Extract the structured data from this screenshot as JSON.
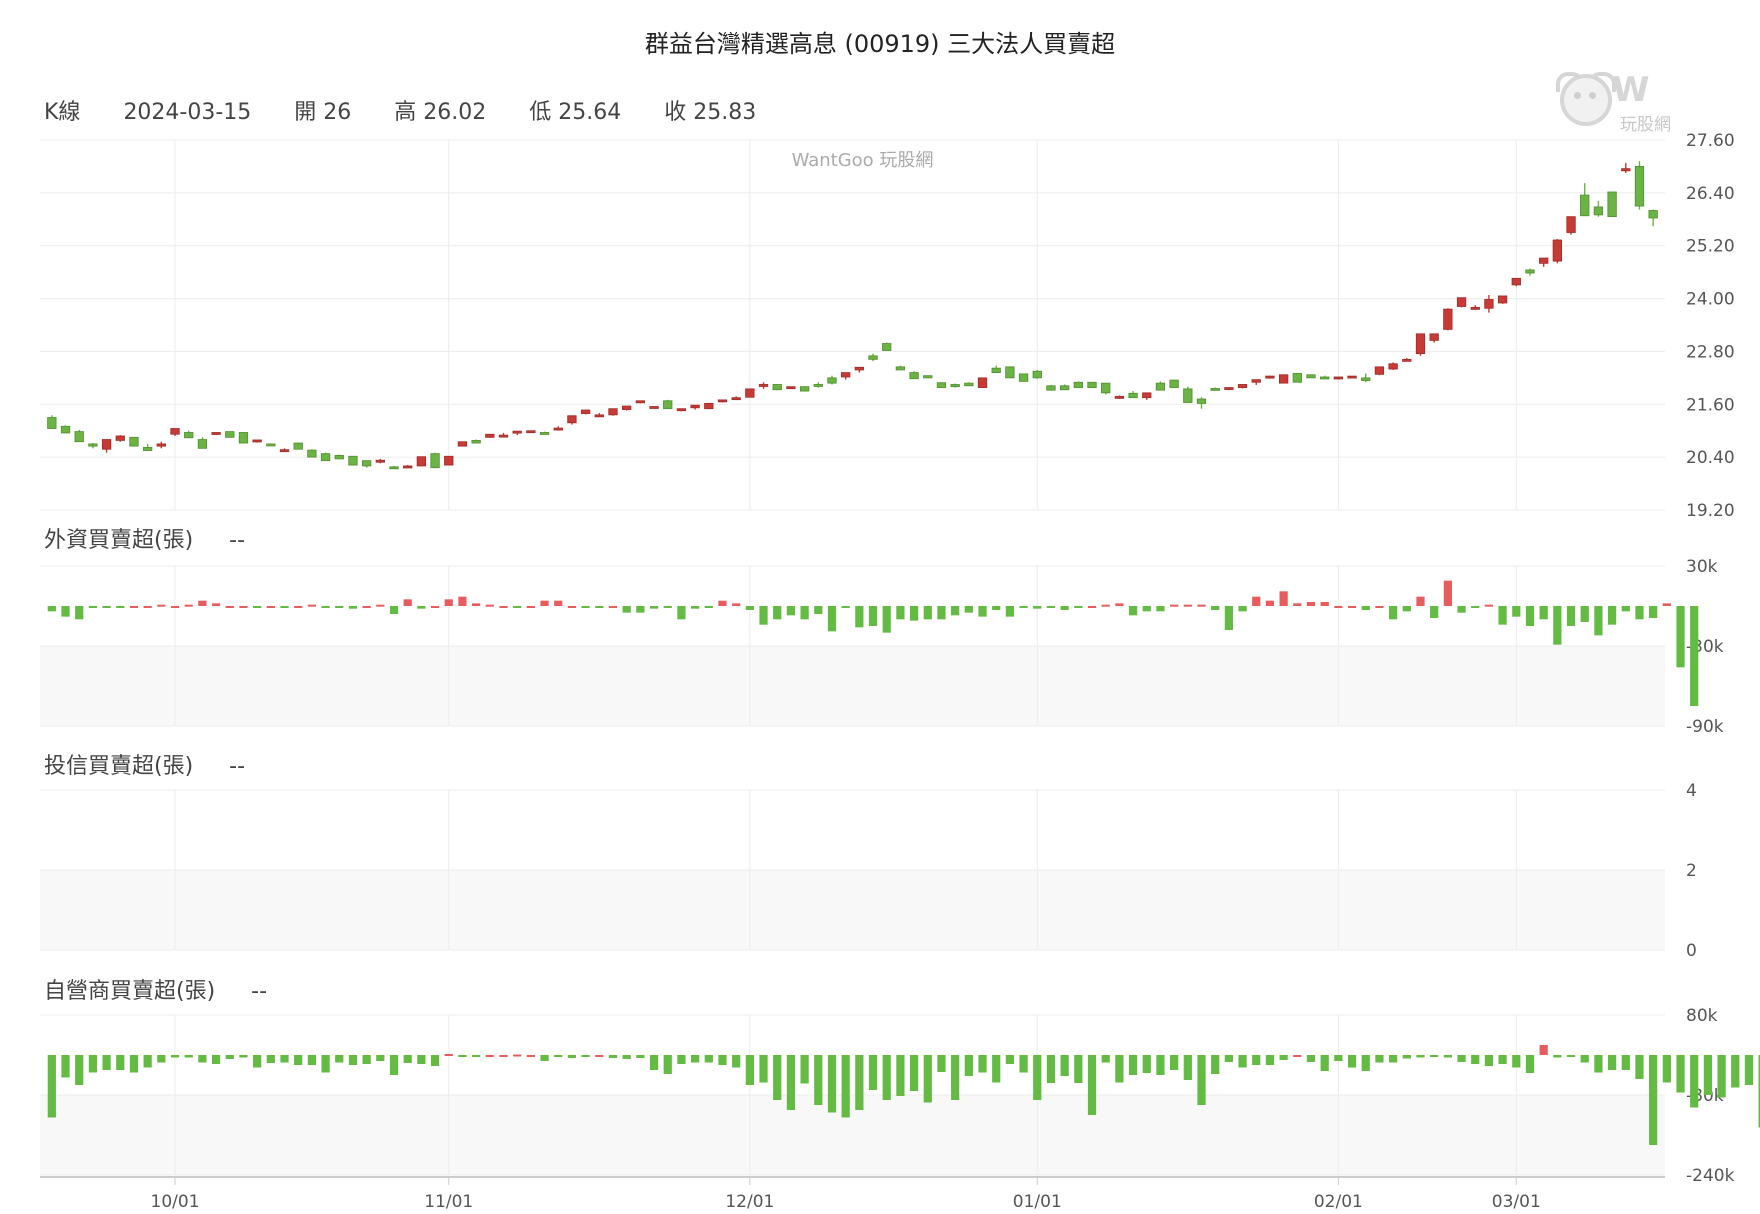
{
  "title": "群益台灣精選高息 (00919) 三大法人買賣超",
  "kline_info": {
    "label": "K線",
    "date": "2024-03-15",
    "open": "開 26",
    "high": "高 26.02",
    "low": "低 25.64",
    "close": "收 25.83"
  },
  "watermark": "WantGoo 玩股網",
  "logo_text": "玩股網",
  "panels": {
    "foreign": {
      "title": "外資買賣超(張)",
      "value": "--"
    },
    "trust": {
      "title": "投信買賣超(張)",
      "value": "--"
    },
    "dealer": {
      "title": "自營商買賣超(張)",
      "value": "--"
    }
  },
  "colors": {
    "up": "#c83a35",
    "down": "#6ab344",
    "up_bar": "#e75c5c",
    "down_bar": "#63bb43",
    "grid": "#ececec",
    "band": "#f8f8f8"
  },
  "chart_data": [
    {
      "type": "candlestick",
      "ylim": [
        19.2,
        27.6
      ],
      "y_ticks": [
        "27.60",
        "26.40",
        "25.20",
        "24.00",
        "22.80",
        "21.60",
        "20.40",
        "19.20"
      ],
      "x_ticks": [
        "10/01",
        "11/01",
        "12/01",
        "01/01",
        "02/01",
        "03/01"
      ],
      "x_tick_index": [
        9,
        29,
        51,
        72,
        94,
        107
      ],
      "ohlc": [
        [
          21.3,
          21.35,
          21.05,
          21.05
        ],
        [
          21.1,
          21.12,
          20.95,
          20.95
        ],
        [
          20.98,
          21.02,
          20.75,
          20.75
        ],
        [
          20.7,
          20.72,
          20.6,
          20.65
        ],
        [
          20.58,
          20.8,
          20.5,
          20.8
        ],
        [
          20.78,
          20.9,
          20.75,
          20.88
        ],
        [
          20.85,
          20.85,
          20.65,
          20.65
        ],
        [
          20.62,
          20.7,
          20.55,
          20.55
        ],
        [
          20.65,
          20.75,
          20.6,
          20.7
        ],
        [
          20.92,
          21.02,
          20.88,
          21.05
        ],
        [
          20.96,
          21.0,
          20.84,
          20.84
        ],
        [
          20.8,
          20.85,
          20.6,
          20.6
        ],
        [
          20.92,
          20.95,
          20.9,
          20.96
        ],
        [
          20.98,
          20.98,
          20.85,
          20.85
        ],
        [
          20.96,
          20.96,
          20.72,
          20.72
        ],
        [
          20.75,
          20.78,
          20.73,
          20.79
        ],
        [
          20.7,
          20.7,
          20.68,
          20.66
        ],
        [
          20.56,
          20.6,
          20.55,
          20.57
        ],
        [
          20.72,
          20.72,
          20.58,
          20.58
        ],
        [
          20.56,
          20.58,
          20.4,
          20.4
        ],
        [
          20.48,
          20.5,
          20.32,
          20.32
        ],
        [
          20.44,
          20.46,
          20.36,
          20.36
        ],
        [
          20.42,
          20.42,
          20.22,
          20.22
        ],
        [
          20.32,
          20.32,
          20.16,
          20.2
        ],
        [
          20.31,
          20.36,
          20.26,
          20.33
        ],
        [
          20.18,
          20.2,
          20.14,
          20.14
        ],
        [
          20.2,
          20.22,
          20.18,
          20.2
        ],
        [
          20.2,
          20.41,
          20.19,
          20.41
        ],
        [
          20.48,
          20.5,
          20.16,
          20.16
        ],
        [
          20.22,
          20.42,
          20.21,
          20.42
        ],
        [
          20.65,
          20.75,
          20.65,
          20.75
        ],
        [
          20.78,
          20.8,
          20.72,
          20.72
        ],
        [
          20.85,
          20.9,
          20.84,
          20.92
        ],
        [
          20.9,
          20.95,
          20.88,
          20.9
        ],
        [
          20.95,
          20.98,
          20.9,
          20.99
        ],
        [
          20.96,
          21.0,
          20.95,
          21.0
        ],
        [
          20.96,
          20.98,
          20.94,
          20.94
        ],
        [
          21.05,
          21.1,
          21.03,
          21.06
        ],
        [
          21.18,
          21.2,
          21.14,
          21.34
        ],
        [
          21.39,
          21.42,
          21.37,
          21.47
        ],
        [
          21.34,
          21.4,
          21.33,
          21.36
        ],
        [
          21.36,
          21.42,
          21.34,
          21.5
        ],
        [
          21.48,
          21.52,
          21.46,
          21.56
        ],
        [
          21.66,
          21.68,
          21.62,
          21.68
        ],
        [
          21.55,
          21.55,
          21.54,
          21.55
        ],
        [
          21.68,
          21.7,
          21.5,
          21.5
        ],
        [
          21.46,
          21.48,
          21.44,
          21.5
        ],
        [
          21.52,
          21.58,
          21.48,
          21.58
        ],
        [
          21.5,
          21.5,
          21.5,
          21.62
        ],
        [
          21.66,
          21.7,
          21.64,
          21.7
        ],
        [
          21.72,
          21.78,
          21.7,
          21.75
        ],
        [
          21.76,
          21.9,
          21.76,
          21.95
        ],
        [
          22.05,
          22.1,
          21.95,
          22.05
        ],
        [
          22.05,
          22.05,
          21.93,
          21.93
        ],
        [
          21.98,
          22.0,
          21.96,
          22.0
        ],
        [
          22.0,
          22.0,
          21.9,
          21.9
        ],
        [
          22.05,
          22.1,
          21.98,
          22.04
        ],
        [
          22.2,
          22.25,
          22.05,
          22.08
        ],
        [
          22.22,
          22.3,
          22.16,
          22.32
        ],
        [
          22.38,
          22.42,
          22.32,
          22.44
        ],
        [
          22.7,
          22.75,
          22.58,
          22.62
        ],
        [
          22.98,
          23.0,
          22.82,
          22.82
        ],
        [
          22.45,
          22.48,
          22.42,
          22.38
        ],
        [
          22.32,
          22.35,
          22.18,
          22.18
        ],
        [
          22.25,
          22.25,
          22.2,
          22.2
        ],
        [
          22.09,
          22.1,
          21.98,
          21.98
        ],
        [
          22.05,
          22.07,
          21.98,
          22.0
        ],
        [
          22.08,
          22.1,
          22.03,
          22.02
        ],
        [
          21.98,
          22.2,
          21.98,
          22.2
        ],
        [
          22.42,
          22.48,
          22.38,
          22.32
        ],
        [
          22.45,
          22.45,
          22.2,
          22.2
        ],
        [
          22.29,
          22.3,
          22.12,
          22.12
        ],
        [
          22.35,
          22.38,
          22.18,
          22.2
        ],
        [
          22.02,
          22.04,
          21.92,
          21.92
        ],
        [
          22.02,
          22.05,
          21.93,
          21.93
        ],
        [
          22.1,
          22.12,
          21.98,
          21.98
        ],
        [
          22.1,
          22.1,
          21.98,
          21.98
        ],
        [
          22.08,
          22.08,
          21.82,
          21.86
        ],
        [
          21.76,
          21.8,
          21.72,
          21.78
        ],
        [
          21.85,
          21.9,
          21.8,
          21.75
        ],
        [
          21.75,
          21.85,
          21.7,
          21.86
        ],
        [
          22.08,
          22.12,
          21.95,
          21.92
        ],
        [
          22.15,
          22.15,
          21.98,
          21.98
        ],
        [
          21.95,
          22.0,
          21.64,
          21.64
        ],
        [
          21.72,
          21.76,
          21.5,
          21.62
        ],
        [
          21.96,
          21.98,
          21.94,
          21.92
        ],
        [
          21.95,
          21.98,
          21.92,
          21.98
        ],
        [
          21.98,
          22.02,
          21.96,
          22.05
        ],
        [
          22.1,
          22.14,
          22.04,
          22.16
        ],
        [
          22.2,
          22.25,
          22.18,
          22.24
        ],
        [
          22.08,
          22.28,
          22.08,
          22.27
        ],
        [
          22.3,
          22.3,
          22.1,
          22.1
        ],
        [
          22.27,
          22.27,
          22.2,
          22.2
        ],
        [
          22.22,
          22.25,
          22.18,
          22.2
        ],
        [
          22.22,
          22.22,
          22.16,
          22.22
        ],
        [
          22.22,
          22.23,
          22.2,
          22.24
        ],
        [
          22.2,
          22.3,
          22.1,
          22.14
        ],
        [
          22.28,
          22.45,
          22.26,
          22.45
        ],
        [
          22.4,
          22.55,
          22.38,
          22.52
        ],
        [
          22.6,
          22.65,
          22.58,
          22.62
        ],
        [
          22.75,
          23.2,
          22.7,
          23.2
        ],
        [
          23.05,
          23.2,
          23.0,
          23.2
        ],
        [
          23.3,
          23.78,
          23.28,
          23.76
        ],
        [
          23.82,
          23.9,
          23.8,
          24.02
        ],
        [
          23.8,
          23.85,
          23.75,
          23.8
        ],
        [
          23.78,
          24.08,
          23.68,
          23.98
        ],
        [
          23.9,
          24.05,
          23.88,
          24.06
        ],
        [
          24.31,
          24.32,
          24.28,
          24.46
        ],
        [
          24.65,
          24.68,
          24.52,
          24.58
        ],
        [
          24.8,
          24.85,
          24.72,
          24.92
        ],
        [
          24.85,
          25.35,
          24.8,
          25.33
        ],
        [
          25.5,
          25.85,
          25.45,
          25.86
        ],
        [
          26.35,
          26.62,
          25.95,
          25.88
        ],
        [
          26.08,
          26.22,
          25.86,
          25.9
        ],
        [
          26.42,
          26.42,
          25.86,
          25.86
        ],
        [
          26.9,
          27.08,
          26.85,
          26.95
        ],
        [
          27.0,
          27.12,
          26.02,
          26.1
        ],
        [
          26.0,
          26.02,
          25.64,
          25.83
        ]
      ],
      "foreign_ylim": [
        -90,
        30
      ],
      "foreign_ticks": [
        "30k",
        "-30k",
        "-90k"
      ],
      "foreign": [
        -4,
        -8,
        -10,
        -1,
        -1,
        -1,
        0,
        0,
        1,
        0,
        1,
        4,
        2,
        0,
        0,
        -1,
        0,
        -1,
        0,
        1,
        -1,
        -1,
        -2,
        0,
        1,
        -6,
        5,
        -2,
        0,
        5,
        7,
        2,
        1,
        0,
        -1,
        0,
        4,
        4,
        0,
        -1,
        -1,
        0,
        -5,
        -5,
        -2,
        -1,
        -10,
        -2,
        -1,
        4,
        2,
        -3,
        -14,
        -10,
        -7,
        -10,
        -6,
        -19,
        -1,
        -16,
        -15,
        -20,
        -10,
        -11,
        -10,
        -10,
        -7,
        -5,
        -8,
        -3,
        -8,
        -1,
        -2,
        -1,
        -3,
        -1,
        0,
        1,
        2,
        -7,
        -4,
        -4,
        1,
        1,
        1,
        -3,
        -18,
        -4,
        7,
        4,
        11,
        2,
        3,
        3,
        0,
        0,
        -3,
        0,
        -10,
        -4,
        7,
        -9,
        19,
        -5,
        -1,
        1,
        -14,
        -8,
        -15,
        -10,
        -29,
        -15,
        -12,
        -22,
        -14,
        -4,
        -10,
        -9,
        2,
        -46,
        -75
      ],
      "trust_ylim": [
        0,
        4
      ],
      "trust_ticks": [
        "4",
        "2",
        "0"
      ],
      "trust": [],
      "dealer_ylim": [
        -240,
        80
      ],
      "dealer_ticks": [
        "80k",
        "-80k",
        "-240k"
      ],
      "dealer": [
        -125,
        -45,
        -60,
        -35,
        -30,
        -30,
        -35,
        -25,
        -15,
        -5,
        -5,
        -15,
        -18,
        -8,
        -5,
        -25,
        -16,
        -15,
        -20,
        -20,
        -35,
        -15,
        -20,
        -18,
        -12,
        -40,
        -16,
        -18,
        -22,
        2,
        -3,
        -4,
        0,
        0,
        1,
        0,
        -12,
        -4,
        -6,
        -3,
        0,
        -6,
        -8,
        -6,
        -30,
        -38,
        -18,
        -15,
        -15,
        -20,
        -25,
        -60,
        -55,
        -90,
        -110,
        -57,
        -100,
        -115,
        -125,
        -110,
        -70,
        -90,
        -82,
        -72,
        -95,
        -34,
        -90,
        -42,
        -35,
        -55,
        -18,
        -35,
        -90,
        -56,
        -42,
        -56,
        -120,
        -15,
        -55,
        -40,
        -36,
        -40,
        -30,
        -50,
        -100,
        -38,
        -14,
        -25,
        -20,
        -20,
        -10,
        0,
        -14,
        -32,
        -12,
        -25,
        -32,
        -15,
        -15,
        -7,
        -5,
        -2,
        -5,
        -14,
        -18,
        -22,
        -18,
        -25,
        -36,
        20,
        -5,
        -4,
        -15,
        -35,
        -30,
        -30,
        -48,
        -180,
        -55,
        -75,
        -105,
        -80,
        -85,
        -65,
        -60,
        -145,
        -160
      ]
    }
  ]
}
